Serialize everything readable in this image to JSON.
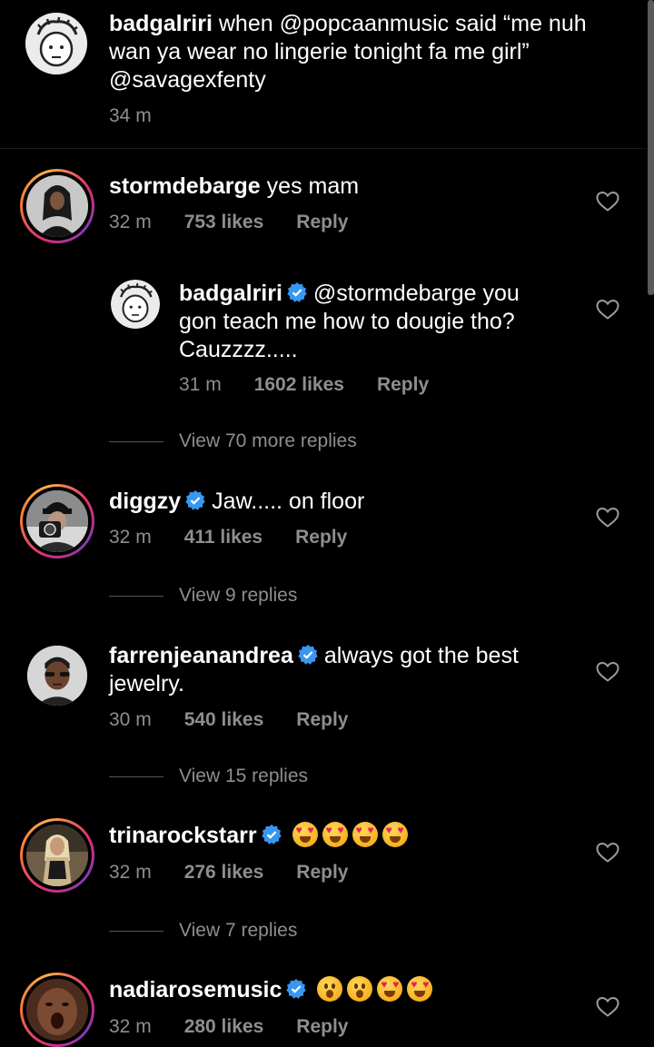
{
  "caption": {
    "username": "badgalriri",
    "text": " when @popcaanmusic said “me nuh wan ya wear no lingerie tonight fa me girl” @savagexfenty",
    "time": "34 m"
  },
  "comments": [
    {
      "username": "stormdebarge",
      "text": " yes mam",
      "time": "32 m",
      "likes": "753 likes",
      "reply": "Reply"
    },
    {
      "username": "badgalriri",
      "text": "@stormdebarge you gon teach me how to dougie  tho? Cauzzzz.....",
      "time": "31 m",
      "likes": "1602 likes",
      "reply": "Reply",
      "view_replies": "View 70 more replies"
    },
    {
      "username": "diggzy",
      "text": "Jaw..... on floor",
      "time": "32 m",
      "likes": "411 likes",
      "reply": "Reply",
      "view_replies": "View 9 replies"
    },
    {
      "username": "farrenjeanandrea",
      "text": "always got the best jewelry.",
      "time": "30 m",
      "likes": "540 likes",
      "reply": "Reply",
      "view_replies": "View 15 replies"
    },
    {
      "username": "trinarockstarr",
      "emojis": [
        "heart-eyes",
        "heart-eyes",
        "heart-eyes",
        "heart-eyes"
      ],
      "time": "32 m",
      "likes": "276 likes",
      "reply": "Reply",
      "view_replies": "View 7 replies"
    },
    {
      "username": "nadiarosemusic",
      "emojis": [
        "astonished",
        "astonished",
        "heart-eyes",
        "heart-eyes"
      ],
      "time": "32 m",
      "likes": "280 likes",
      "reply": "Reply"
    }
  ],
  "colors": {
    "background": "#000000",
    "secondary_text": "#8e8e8e",
    "verified_blue": "#3897f0"
  }
}
